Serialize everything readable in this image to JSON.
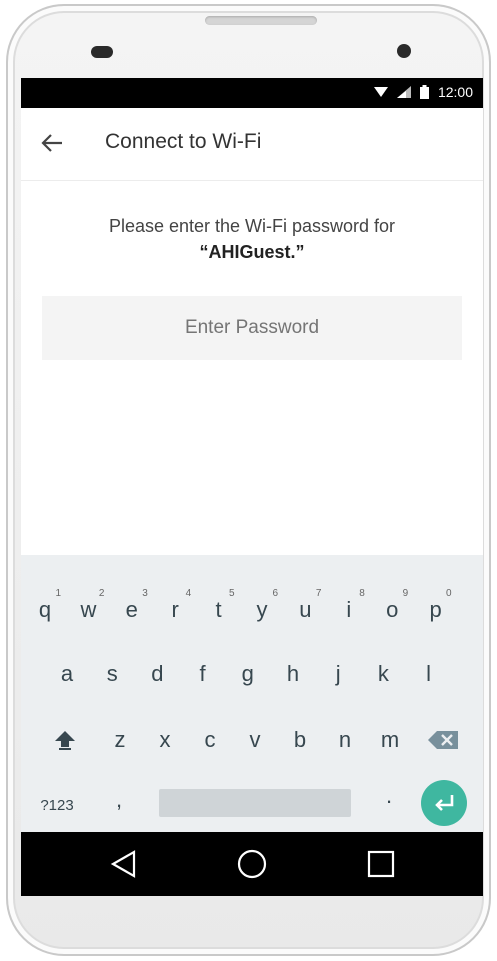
{
  "status_bar": {
    "time": "12:00",
    "icons": [
      "wifi-icon",
      "signal-icon",
      "battery-icon"
    ]
  },
  "app_bar": {
    "title": "Connect to Wi-Fi",
    "back_icon": "arrow-left-icon"
  },
  "prompt": {
    "line1": "Please enter the Wi-Fi password for",
    "ssid": "“AHIGuest.”"
  },
  "password_field": {
    "placeholder": "Enter Password",
    "value": ""
  },
  "keyboard": {
    "row1": [
      {
        "k": "q",
        "h": "1"
      },
      {
        "k": "w",
        "h": "2"
      },
      {
        "k": "e",
        "h": "3"
      },
      {
        "k": "r",
        "h": "4"
      },
      {
        "k": "t",
        "h": "5"
      },
      {
        "k": "y",
        "h": "6"
      },
      {
        "k": "u",
        "h": "7"
      },
      {
        "k": "i",
        "h": "8"
      },
      {
        "k": "o",
        "h": "9"
      },
      {
        "k": "p",
        "h": "0"
      }
    ],
    "row2": [
      "a",
      "s",
      "d",
      "f",
      "g",
      "h",
      "j",
      "k",
      "l"
    ],
    "row3": [
      "z",
      "x",
      "c",
      "v",
      "b",
      "n",
      "m"
    ],
    "symbols_label": "?123",
    "comma": ",",
    "period": ".",
    "shift_icon": "shift-icon",
    "backspace_icon": "backspace-icon",
    "enter_icon": "enter-icon"
  },
  "nav_bar": {
    "icons": [
      "back-triangle-icon",
      "home-circle-icon",
      "recents-square-icon"
    ]
  },
  "colors": {
    "accent": "#3fb7a0",
    "keyboard_bg": "#eceff1",
    "status_bar": "#000000"
  }
}
